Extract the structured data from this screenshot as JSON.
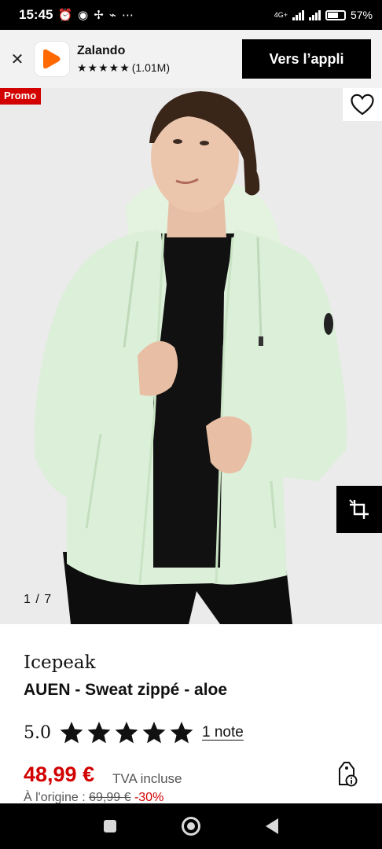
{
  "status_bar": {
    "time": "15:45",
    "network": "4G+",
    "battery": "57%",
    "battery_level": 0.57
  },
  "app_banner": {
    "app_name": "Zalando",
    "rating_stars": "★★★★★",
    "rating_count": "(1.01M)",
    "open_app_label": "Vers l’appli"
  },
  "gallery": {
    "promo_badge": "Promo",
    "image_counter": "1 / 7",
    "current_image": 1,
    "total_images": 7
  },
  "product": {
    "brand": "Icepeak",
    "name": "AUEN - Sweat zippé - aloe",
    "rating_score": "5.0",
    "rating_value": 5,
    "rating_link": "1 note",
    "price": "48,99 €",
    "vat_label": "TVA incluse",
    "original_label": "À l'origine :",
    "original_price": "69,99 €",
    "discount": "-30%"
  },
  "colors": {
    "promo_red": "#d20000",
    "zalando_orange": "#ff6900",
    "jacket_mint": "#dcefd9",
    "background": "#ebebeb"
  },
  "icons": [
    "close-icon",
    "zalando-logo-icon",
    "heart-icon",
    "compare-icon",
    "star-icon",
    "price-info-icon",
    "nav-recents-icon",
    "nav-home-icon",
    "nav-back-icon"
  ]
}
